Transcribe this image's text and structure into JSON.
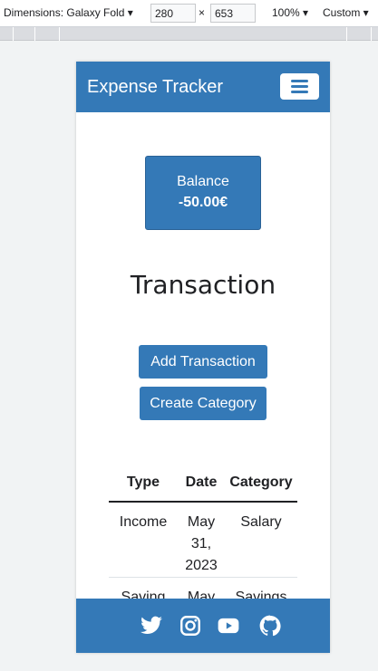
{
  "devtools": {
    "dimensions_label": "Dimensions: Galaxy Fold",
    "width_value": "280",
    "height_value": "653",
    "times": "×",
    "zoom": "100%",
    "throttle": "Custom"
  },
  "navbar": {
    "brand": "Expense Tracker"
  },
  "balance": {
    "label": "Balance",
    "amount": "-50.00€"
  },
  "heading": "Transaction",
  "buttons": {
    "add": "Add Transaction",
    "create_category": "Create Category"
  },
  "table": {
    "headers": [
      "Type",
      "Date",
      "Category"
    ],
    "rows": [
      [
        "Income",
        "May 31, 2023",
        "Salary"
      ],
      [
        "Saving",
        "May",
        "Savings"
      ]
    ]
  },
  "footer": {
    "icons": [
      "twitter-icon",
      "instagram-icon",
      "youtube-icon",
      "github-icon"
    ]
  },
  "colors": {
    "primary": "#3479b7"
  }
}
